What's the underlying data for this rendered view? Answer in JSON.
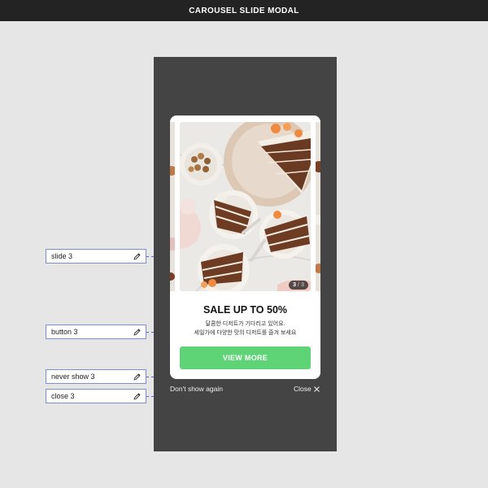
{
  "app": {
    "title": "CAROUSEL SLIDE MODAL"
  },
  "modal": {
    "counter": {
      "current": "3",
      "separator": "/",
      "total": "3"
    },
    "headline": "SALE UP TO 50%",
    "description_line1": "달콤한 디저트가 기다리고 있어요.",
    "description_line2": "세일가에 다양한 맛의 디저트를 즐겨 보세요",
    "cta_label": "VIEW MORE",
    "never_show_label": "Don't show again",
    "close_label": "Close"
  },
  "annotations": [
    {
      "label": "slide 3",
      "icon": "pencil-icon"
    },
    {
      "label": "button 3",
      "icon": "pencil-icon"
    },
    {
      "label": "never show 3",
      "icon": "pencil-icon"
    },
    {
      "label": "close 3",
      "icon": "pencil-icon"
    }
  ],
  "colors": {
    "top_bar": "#232323",
    "canvas": "#e6e6e6",
    "phone_background": "#444444",
    "cta_green": "#5fd477",
    "annotation_border": "#7d8cd6"
  }
}
